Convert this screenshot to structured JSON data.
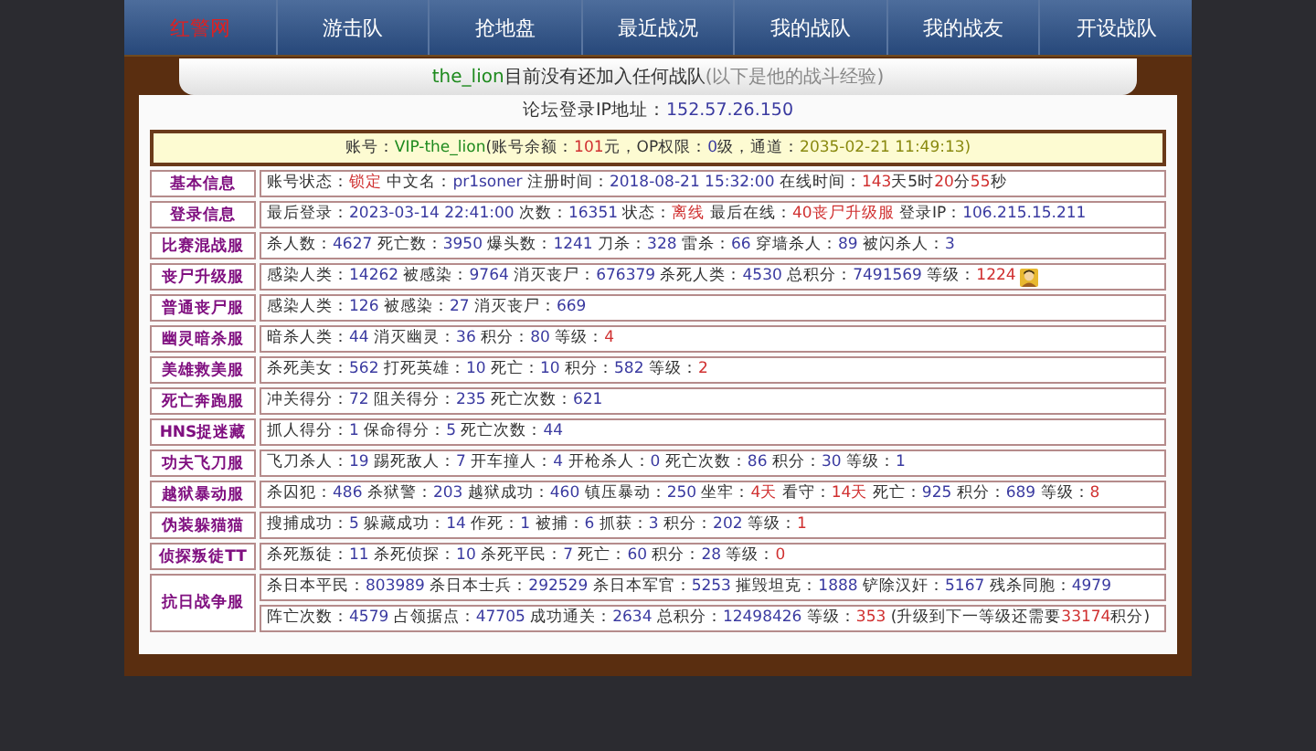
{
  "nav": [
    {
      "label": "红警网",
      "selected": true
    },
    {
      "label": "游击队",
      "selected": false
    },
    {
      "label": "抢地盘",
      "selected": false
    },
    {
      "label": "最近战况",
      "selected": false
    },
    {
      "label": "我的战队",
      "selected": false
    },
    {
      "label": "我的战友",
      "selected": false
    },
    {
      "label": "开设战队",
      "selected": false
    }
  ],
  "banner": {
    "name": "the_lion",
    "text": "目前没有还加入任何战队",
    "note": "(以下是他的战斗经验)"
  },
  "ip": {
    "label": "论坛登录IP地址：",
    "value": "152.57.26.150"
  },
  "account": [
    {
      "t": "账号：",
      "kind": "label"
    },
    {
      "t": "VIP-the_lion",
      "kind": "name"
    },
    {
      "t": "(账号余额：",
      "kind": "label"
    },
    {
      "t": "101",
      "kind": "alert"
    },
    {
      "t": "元，OP权限：",
      "kind": "label"
    },
    {
      "t": "0",
      "kind": "value"
    },
    {
      "t": "级，通道：",
      "kind": "label"
    },
    {
      "t": "2035-02-21 11:49:13)",
      "kind": "date"
    }
  ],
  "rows": [
    {
      "title": "基本信息",
      "icon": false,
      "lines": [
        [
          {
            "t": "账号状态：",
            "kind": "label"
          },
          {
            "t": "锁定",
            "kind": "alert"
          },
          {
            "t": " 中文名：",
            "kind": "label"
          },
          {
            "t": "pr1soner",
            "kind": "value"
          },
          {
            "t": " 注册时间：",
            "kind": "label"
          },
          {
            "t": "2018-08-21 15:32:00",
            "kind": "value"
          },
          {
            "t": " 在线时间：",
            "kind": "label"
          },
          {
            "t": "143",
            "kind": "alert"
          },
          {
            "t": "天5时",
            "kind": "label"
          },
          {
            "t": "20",
            "kind": "alert"
          },
          {
            "t": "分",
            "kind": "label"
          },
          {
            "t": "55",
            "kind": "alert"
          },
          {
            "t": "秒",
            "kind": "label"
          }
        ]
      ]
    },
    {
      "title": "登录信息",
      "icon": false,
      "lines": [
        [
          {
            "t": "最后登录：",
            "kind": "label"
          },
          {
            "t": "2023-03-14 22:41:00",
            "kind": "value"
          },
          {
            "t": " 次数：",
            "kind": "label"
          },
          {
            "t": "16351",
            "kind": "value"
          },
          {
            "t": " 状态：",
            "kind": "label"
          },
          {
            "t": "离线",
            "kind": "alert"
          },
          {
            "t": " 最后在线：",
            "kind": "label"
          },
          {
            "t": "40丧尸升级服",
            "kind": "alert"
          },
          {
            "t": " 登录IP：",
            "kind": "label"
          },
          {
            "t": "106.215.15.211",
            "kind": "value"
          }
        ]
      ]
    },
    {
      "title": "比赛混战服",
      "icon": false,
      "lines": [
        [
          {
            "t": "杀人数：",
            "kind": "label"
          },
          {
            "t": "4627",
            "kind": "value"
          },
          {
            "t": " 死亡数：",
            "kind": "label"
          },
          {
            "t": "3950",
            "kind": "value"
          },
          {
            "t": " 爆头数：",
            "kind": "label"
          },
          {
            "t": "1241",
            "kind": "value"
          },
          {
            "t": " 刀杀：",
            "kind": "label"
          },
          {
            "t": "328",
            "kind": "value"
          },
          {
            "t": " 雷杀：",
            "kind": "label"
          },
          {
            "t": "66",
            "kind": "value"
          },
          {
            "t": " 穿墙杀人：",
            "kind": "label"
          },
          {
            "t": "89",
            "kind": "value"
          },
          {
            "t": " 被闪杀人：",
            "kind": "label"
          },
          {
            "t": "3",
            "kind": "value"
          }
        ]
      ]
    },
    {
      "title": "丧尸升级服",
      "icon": true,
      "lines": [
        [
          {
            "t": "感染人类：",
            "kind": "label"
          },
          {
            "t": "14262",
            "kind": "value"
          },
          {
            "t": " 被感染：",
            "kind": "label"
          },
          {
            "t": "9764",
            "kind": "value"
          },
          {
            "t": " 消灭丧尸：",
            "kind": "label"
          },
          {
            "t": "676379",
            "kind": "value"
          },
          {
            "t": " 杀死人类：",
            "kind": "label"
          },
          {
            "t": "4530",
            "kind": "value"
          },
          {
            "t": " 总积分：",
            "kind": "label"
          },
          {
            "t": "7491569",
            "kind": "value"
          },
          {
            "t": " 等级：",
            "kind": "label"
          },
          {
            "t": "1224",
            "kind": "alert"
          }
        ]
      ]
    },
    {
      "title": "普通丧尸服",
      "icon": false,
      "lines": [
        [
          {
            "t": "感染人类：",
            "kind": "label"
          },
          {
            "t": "126",
            "kind": "value"
          },
          {
            "t": " 被感染：",
            "kind": "label"
          },
          {
            "t": "27",
            "kind": "value"
          },
          {
            "t": " 消灭丧尸：",
            "kind": "label"
          },
          {
            "t": "669",
            "kind": "value"
          }
        ]
      ]
    },
    {
      "title": "幽灵暗杀服",
      "icon": false,
      "lines": [
        [
          {
            "t": "暗杀人类：",
            "kind": "label"
          },
          {
            "t": "44",
            "kind": "value"
          },
          {
            "t": " 消灭幽灵：",
            "kind": "label"
          },
          {
            "t": "36",
            "kind": "value"
          },
          {
            "t": " 积分：",
            "kind": "label"
          },
          {
            "t": "80",
            "kind": "value"
          },
          {
            "t": " 等级：",
            "kind": "label"
          },
          {
            "t": "4",
            "kind": "alert"
          }
        ]
      ]
    },
    {
      "title": "美雄救美服",
      "icon": false,
      "lines": [
        [
          {
            "t": "杀死美女：",
            "kind": "label"
          },
          {
            "t": "562",
            "kind": "value"
          },
          {
            "t": " 打死英雄：",
            "kind": "label"
          },
          {
            "t": "10",
            "kind": "value"
          },
          {
            "t": " 死亡：",
            "kind": "label"
          },
          {
            "t": "10",
            "kind": "value"
          },
          {
            "t": " 积分：",
            "kind": "label"
          },
          {
            "t": "582",
            "kind": "value"
          },
          {
            "t": " 等级：",
            "kind": "label"
          },
          {
            "t": "2",
            "kind": "alert"
          }
        ]
      ]
    },
    {
      "title": "死亡奔跑服",
      "icon": false,
      "lines": [
        [
          {
            "t": "冲关得分：",
            "kind": "label"
          },
          {
            "t": "72",
            "kind": "value"
          },
          {
            "t": " 阻关得分：",
            "kind": "label"
          },
          {
            "t": "235",
            "kind": "value"
          },
          {
            "t": " 死亡次数：",
            "kind": "label"
          },
          {
            "t": "621",
            "kind": "value"
          }
        ]
      ]
    },
    {
      "title": "HNS捉迷藏",
      "icon": false,
      "lines": [
        [
          {
            "t": "抓人得分：",
            "kind": "label"
          },
          {
            "t": "1",
            "kind": "value"
          },
          {
            "t": " 保命得分：",
            "kind": "label"
          },
          {
            "t": "5",
            "kind": "value"
          },
          {
            "t": " 死亡次数：",
            "kind": "label"
          },
          {
            "t": "44",
            "kind": "value"
          }
        ]
      ]
    },
    {
      "title": "功夫飞刀服",
      "icon": false,
      "lines": [
        [
          {
            "t": "飞刀杀人：",
            "kind": "label"
          },
          {
            "t": "19",
            "kind": "value"
          },
          {
            "t": " 踢死敌人：",
            "kind": "label"
          },
          {
            "t": "7",
            "kind": "value"
          },
          {
            "t": " 开车撞人：",
            "kind": "label"
          },
          {
            "t": "4",
            "kind": "value"
          },
          {
            "t": " 开枪杀人：",
            "kind": "label"
          },
          {
            "t": "0",
            "kind": "value"
          },
          {
            "t": " 死亡次数：",
            "kind": "label"
          },
          {
            "t": "86",
            "kind": "value"
          },
          {
            "t": " 积分：",
            "kind": "label"
          },
          {
            "t": "30",
            "kind": "value"
          },
          {
            "t": " 等级：",
            "kind": "label"
          },
          {
            "t": "1",
            "kind": "value"
          }
        ]
      ]
    },
    {
      "title": "越狱暴动服",
      "icon": false,
      "lines": [
        [
          {
            "t": "杀囚犯：",
            "kind": "label"
          },
          {
            "t": "486",
            "kind": "value"
          },
          {
            "t": " 杀狱警：",
            "kind": "label"
          },
          {
            "t": "203",
            "kind": "value"
          },
          {
            "t": " 越狱成功：",
            "kind": "label"
          },
          {
            "t": "460",
            "kind": "value"
          },
          {
            "t": " 镇压暴动：",
            "kind": "label"
          },
          {
            "t": "250",
            "kind": "value"
          },
          {
            "t": " 坐牢：",
            "kind": "label"
          },
          {
            "t": "4天",
            "kind": "alert"
          },
          {
            "t": " 看守：",
            "kind": "label"
          },
          {
            "t": "14天",
            "kind": "alert"
          },
          {
            "t": " 死亡：",
            "kind": "label"
          },
          {
            "t": "925",
            "kind": "value"
          },
          {
            "t": " 积分：",
            "kind": "label"
          },
          {
            "t": "689",
            "kind": "value"
          },
          {
            "t": " 等级：",
            "kind": "label"
          },
          {
            "t": "8",
            "kind": "alert"
          }
        ]
      ]
    },
    {
      "title": "伪装躲猫猫",
      "icon": false,
      "lines": [
        [
          {
            "t": "搜捕成功：",
            "kind": "label"
          },
          {
            "t": "5",
            "kind": "value"
          },
          {
            "t": " 躲藏成功：",
            "kind": "label"
          },
          {
            "t": "14",
            "kind": "value"
          },
          {
            "t": " 作死：",
            "kind": "label"
          },
          {
            "t": "1",
            "kind": "value"
          },
          {
            "t": " 被捕：",
            "kind": "label"
          },
          {
            "t": "6",
            "kind": "value"
          },
          {
            "t": " 抓获：",
            "kind": "label"
          },
          {
            "t": "3",
            "kind": "value"
          },
          {
            "t": " 积分：",
            "kind": "label"
          },
          {
            "t": "202",
            "kind": "value"
          },
          {
            "t": " 等级：",
            "kind": "label"
          },
          {
            "t": "1",
            "kind": "alert"
          }
        ]
      ]
    },
    {
      "title": "侦探叛徒TT",
      "icon": false,
      "lines": [
        [
          {
            "t": "杀死叛徒：",
            "kind": "label"
          },
          {
            "t": "11",
            "kind": "value"
          },
          {
            "t": " 杀死侦探：",
            "kind": "label"
          },
          {
            "t": "10",
            "kind": "value"
          },
          {
            "t": " 杀死平民：",
            "kind": "label"
          },
          {
            "t": "7",
            "kind": "value"
          },
          {
            "t": " 死亡：",
            "kind": "label"
          },
          {
            "t": "60",
            "kind": "value"
          },
          {
            "t": " 积分：",
            "kind": "label"
          },
          {
            "t": "28",
            "kind": "value"
          },
          {
            "t": " 等级：",
            "kind": "label"
          },
          {
            "t": "0",
            "kind": "alert"
          }
        ]
      ]
    },
    {
      "title": "抗日战争服",
      "icon": false,
      "lines": [
        [
          {
            "t": "杀日本平民：",
            "kind": "label"
          },
          {
            "t": "803989",
            "kind": "value"
          },
          {
            "t": " 杀日本士兵：",
            "kind": "label"
          },
          {
            "t": "292529",
            "kind": "value"
          },
          {
            "t": " 杀日本军官：",
            "kind": "label"
          },
          {
            "t": "5253",
            "kind": "value"
          },
          {
            "t": " 摧毁坦克：",
            "kind": "label"
          },
          {
            "t": "1888",
            "kind": "value"
          },
          {
            "t": " 铲除汉奸：",
            "kind": "label"
          },
          {
            "t": "5167",
            "kind": "value"
          },
          {
            "t": " 残杀同胞：",
            "kind": "label"
          },
          {
            "t": "4979",
            "kind": "value"
          }
        ],
        [
          {
            "t": "阵亡次数：",
            "kind": "label"
          },
          {
            "t": "4579",
            "kind": "value"
          },
          {
            "t": " 占领据点：",
            "kind": "label"
          },
          {
            "t": "47705",
            "kind": "value"
          },
          {
            "t": " 成功通关：",
            "kind": "label"
          },
          {
            "t": "2634",
            "kind": "value"
          },
          {
            "t": " 总积分：",
            "kind": "label"
          },
          {
            "t": "12498426",
            "kind": "value"
          },
          {
            "t": " 等级：",
            "kind": "label"
          },
          {
            "t": "353",
            "kind": "alert"
          },
          {
            "t": " (升级到下一等级还需要",
            "kind": "label"
          },
          {
            "t": "33174",
            "kind": "alert"
          },
          {
            "t": "积分)",
            "kind": "label"
          }
        ]
      ]
    }
  ]
}
